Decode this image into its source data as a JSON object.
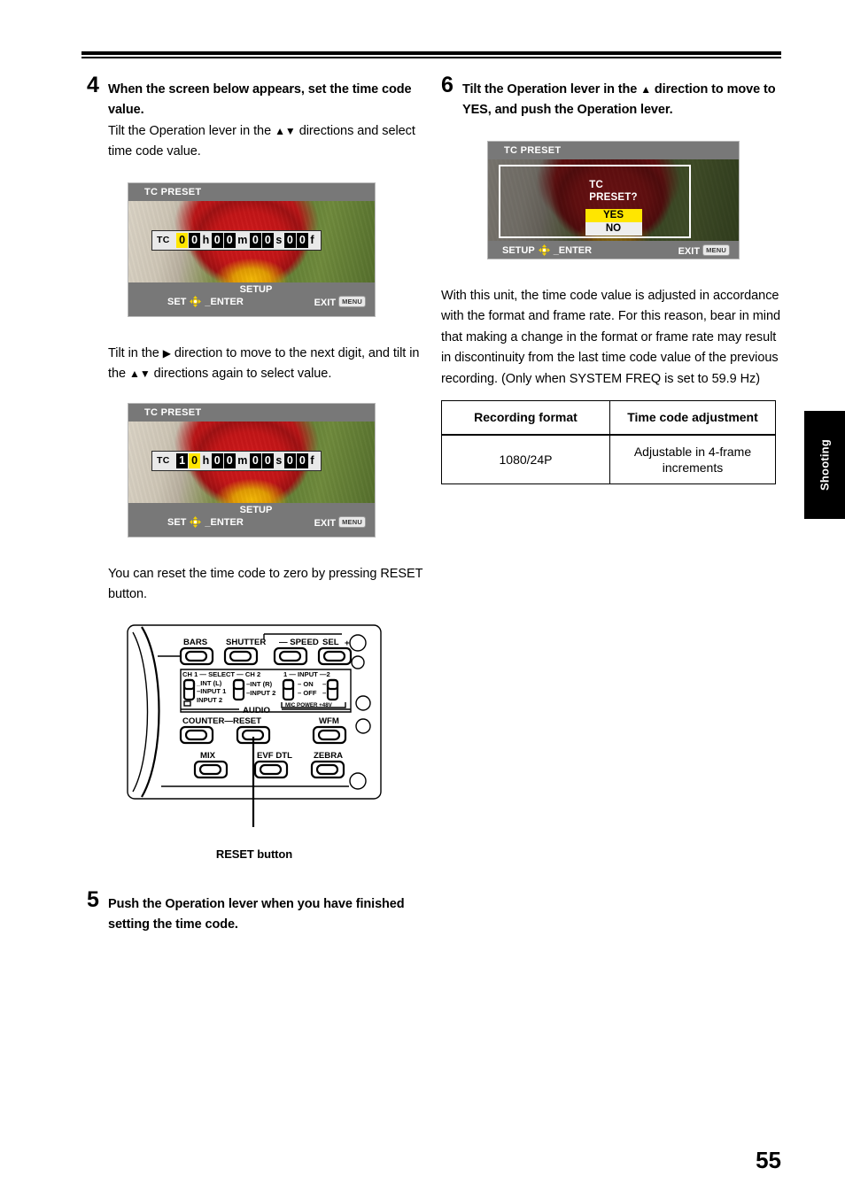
{
  "page": {
    "number": "55",
    "side_tab": "Shooting"
  },
  "left_column": {
    "step4": {
      "number": "4",
      "heading": "When the screen below appears, set the time code value.",
      "body_pre": "Tilt the Operation lever in the",
      "body_arrows": "▲▼",
      "body_post": "directions and select time code value."
    },
    "screen1": {
      "title": "TC PRESET",
      "tc_label": "TC",
      "digits": [
        "0",
        "0",
        "0",
        "0",
        "0",
        "0",
        "0",
        "0"
      ],
      "highlight_index": 0,
      "unit_h": "h",
      "unit_m": "m",
      "unit_s": "s",
      "unit_f": "f",
      "footer_setup": "SETUP",
      "footer_set": "SET",
      "footer_enter": "_ENTER",
      "footer_exit": "EXIT",
      "footer_menu_badge": "MENU"
    },
    "note1": {
      "pre": "Tilt in the",
      "arrow_right": "▶",
      "mid": "direction to move to the next digit, and tilt in the",
      "arrows_ud": "▲▼",
      "post": "directions again to select value."
    },
    "screen2": {
      "title": "TC PRESET",
      "tc_label": "TC",
      "digits": [
        "1",
        "0",
        "0",
        "0",
        "0",
        "0",
        "0",
        "0"
      ],
      "highlight_index": 1,
      "unit_h": "h",
      "unit_m": "m",
      "unit_s": "s",
      "unit_f": "f",
      "footer_setup": "SETUP",
      "footer_set": "SET",
      "footer_enter": "_ENTER",
      "footer_exit": "EXIT",
      "footer_menu_badge": "MENU"
    },
    "note2": "You can reset the time code to zero by pressing RESET button.",
    "panel": {
      "labels": {
        "bars": "BARS",
        "shutter": "SHUTTER",
        "speed": "— SPEED",
        "sel": "SEL",
        "sel_plus": "+",
        "ch1_select_ch2": "CH 1 — SELECT — CH 2",
        "int_l": "INT (L)",
        "input1": "INPUT 1",
        "input2_a": "INPUT 2",
        "int_r": "INT (R)",
        "input2_b": "INPUT 2",
        "input_1_2": "1 — INPUT — 2",
        "on": "ON",
        "off": "OFF",
        "mic_power": "MIC POWER +48V",
        "audio": "AUDIO",
        "counter_reset": "COUNTER—RESET",
        "wfm": "WFM",
        "mix": "MIX",
        "evf_dtl": "EVF DTL",
        "zebra": "ZEBRA"
      },
      "callout": "RESET button"
    },
    "step5": {
      "number": "5",
      "heading": "Push the Operation lever when you have finished setting the time code."
    }
  },
  "right_column": {
    "step6": {
      "number": "6",
      "heading_pre": "Tilt the Operation lever in the",
      "heading_arrow": "▲",
      "heading_post": "direction to move to YES, and push the Operation lever."
    },
    "screen3": {
      "title": "TC PRESET",
      "confirm_line1": "TC",
      "confirm_line2": "PRESET?",
      "yes": "YES",
      "no": "NO",
      "footer_setup": "SETUP",
      "footer_enter": "_ENTER",
      "footer_exit": "EXIT",
      "footer_menu_badge": "MENU"
    },
    "body": "With this unit, the time code value is adjusted in accordance with the format and frame rate. For this reason, bear in mind that making a change in the format or frame rate may result in discontinuity from the last time code value of the previous recording. (Only when SYSTEM FREQ is set to 59.9 Hz)",
    "table": {
      "headers": [
        "Recording format",
        "Time code adjustment"
      ],
      "rows": [
        [
          "1080/24P",
          "Adjustable in 4-frame increments"
        ]
      ]
    }
  },
  "colors": {
    "lcd_bar": "#787878",
    "highlight_yellow": "#ffe600",
    "digit_bg": "#000000",
    "tc_bar_bg": "#e9e9e9"
  }
}
